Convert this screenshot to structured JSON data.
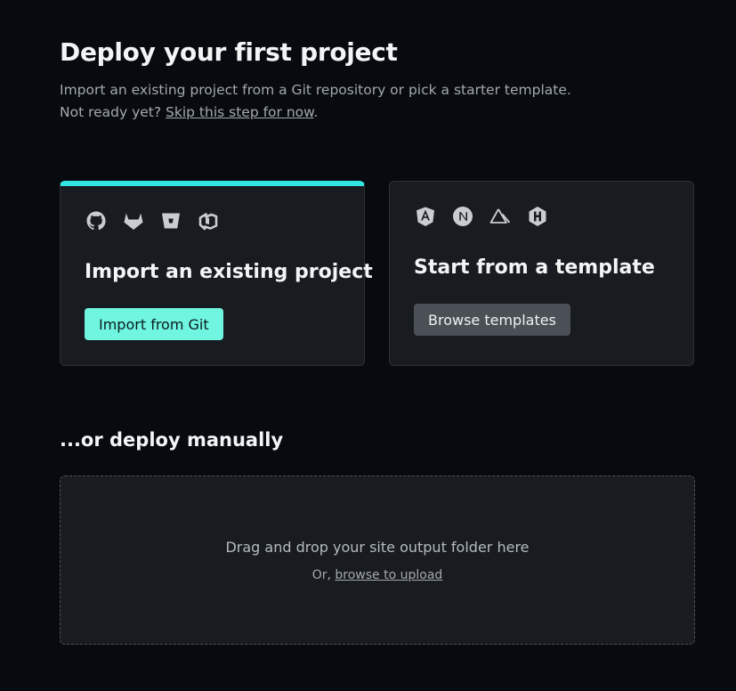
{
  "header": {
    "title": "Deploy your first project",
    "subtitle": "Import an existing project from a Git repository or pick a starter template.",
    "not_ready_prefix": "Not ready yet?",
    "skip_link": "Skip this step for now",
    "not_ready_suffix": "."
  },
  "import_card": {
    "icons": [
      "github-icon",
      "gitlab-icon",
      "bitbucket-icon",
      "azure-devops-icon"
    ],
    "title": "Import an existing project",
    "button": "Import from Git",
    "accent_color": "#32e6e2"
  },
  "template_card": {
    "icons": [
      "angular-icon",
      "nextjs-icon",
      "nuxt-icon",
      "hugo-icon"
    ],
    "title": "Start from a template",
    "button": "Browse templates"
  },
  "manual": {
    "title": "...or deploy manually",
    "drop_text": "Drag and drop your site output folder here",
    "or_prefix": "Or,",
    "browse_link": "browse to upload"
  }
}
